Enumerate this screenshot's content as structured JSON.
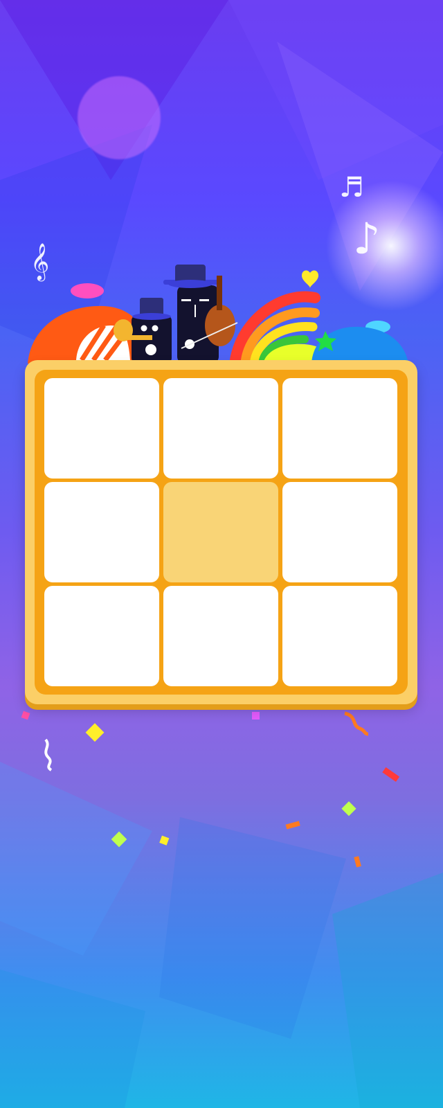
{
  "game": {
    "board": {
      "rows": 3,
      "cols": 3,
      "cells": [
        {
          "id": "cell-1",
          "state": "empty"
        },
        {
          "id": "cell-2",
          "state": "empty"
        },
        {
          "id": "cell-3",
          "state": "empty"
        },
        {
          "id": "cell-4",
          "state": "empty"
        },
        {
          "id": "cell-5",
          "state": "center"
        },
        {
          "id": "cell-6",
          "state": "empty"
        },
        {
          "id": "cell-7",
          "state": "empty"
        },
        {
          "id": "cell-8",
          "state": "empty"
        },
        {
          "id": "cell-9",
          "state": "empty"
        }
      ]
    },
    "icons": {
      "treble_clef": "𝄞",
      "sixteenth_notes": "♬",
      "eighth_note": "♪"
    },
    "colors": {
      "board_frame": "#fbcf67",
      "board_inner": "#f5a315",
      "cell": "#ffffff",
      "center_cell": "#f9d476"
    }
  }
}
